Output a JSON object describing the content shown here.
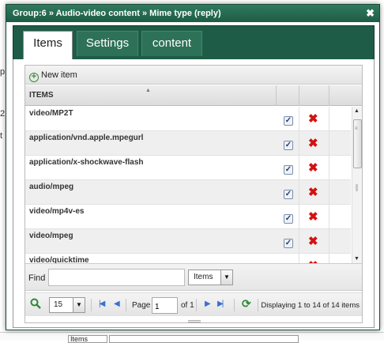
{
  "dialog": {
    "title": "Group:6 » Audio-video content » Mime type (reply)",
    "close_glyph": "✖"
  },
  "tabs": [
    {
      "label": "Items",
      "active": true
    },
    {
      "label": "Settings",
      "active": false
    },
    {
      "label": "content",
      "active": false
    }
  ],
  "toolbar": {
    "new_item_label": "New item",
    "icon": "plus-circle-icon"
  },
  "grid": {
    "column_header": "ITEMS",
    "rows": [
      {
        "name": "video/MP2T",
        "checked": true
      },
      {
        "name": "application/vnd.apple.mpegurl",
        "checked": true
      },
      {
        "name": "application/x-shockwave-flash",
        "checked": true
      },
      {
        "name": "audio/mpeg",
        "checked": true
      },
      {
        "name": "video/mp4v-es",
        "checked": true
      },
      {
        "name": "video/mpeg",
        "checked": true
      },
      {
        "name": "video/quicktime",
        "checked": true
      }
    ],
    "check_glyph": "✓",
    "delete_glyph": "✖"
  },
  "find": {
    "label": "Find",
    "input_value": "",
    "field_select": "Items"
  },
  "pager": {
    "page_size": "15",
    "page_label": "Page",
    "page_value": "1",
    "of_label": "of 1",
    "display_text": "Displaying 1 to 14 of 14 items"
  },
  "background": {
    "bottom_select": "Items"
  },
  "colors": {
    "title_bar": "#1e5c45",
    "tab_bar": "#1e5c47",
    "delete": "#d31212",
    "nav": "#3c6fcf"
  }
}
